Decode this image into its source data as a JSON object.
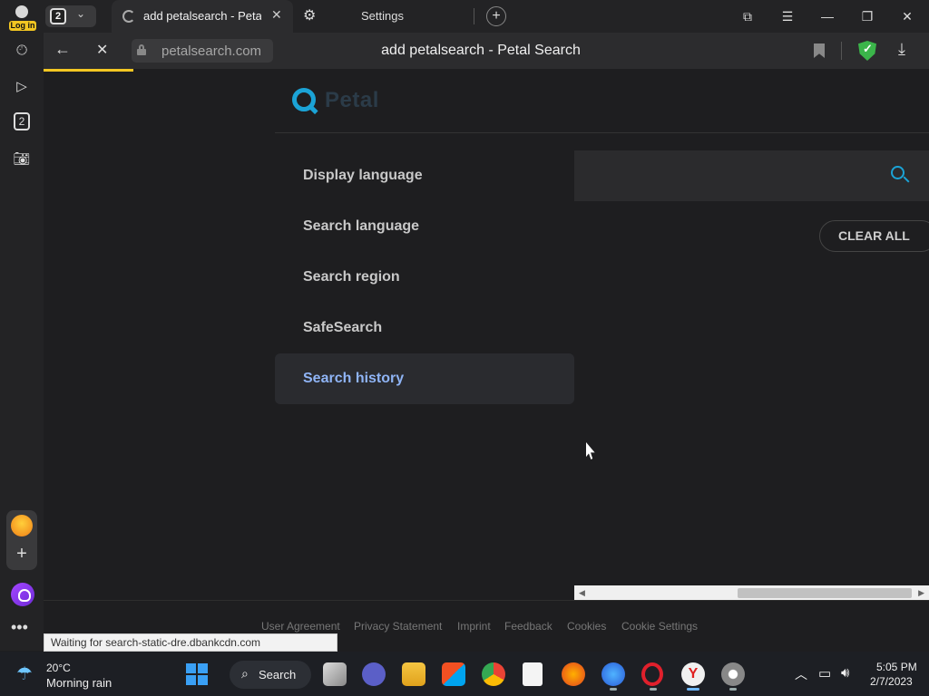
{
  "browser": {
    "login_label": "Log in",
    "tab_count": "2",
    "tabs": [
      {
        "title": "add petalsearch - Petal Search",
        "close": "✕"
      },
      {
        "title": "Settings"
      }
    ],
    "new_tab": "+",
    "window_controls": {
      "minimize": "—",
      "restore": "❐",
      "close": "✕",
      "menu": "☰",
      "collections": "⧉"
    },
    "url": "petalsearch.com",
    "page_title": "add petalsearch - Petal Search",
    "loading_progress": 0.1
  },
  "sidebar": {
    "icons": [
      "history-icon",
      "play-icon",
      "tabs-icon",
      "screenshot-icon",
      "mail-icon",
      "add-icon",
      "alice-icon",
      "more-icon"
    ],
    "tabs_badge": "2"
  },
  "page": {
    "logo_text": "Petal",
    "menu": [
      {
        "label": "Display language"
      },
      {
        "label": "Search language"
      },
      {
        "label": "Search region"
      },
      {
        "label": "SafeSearch"
      },
      {
        "label": "Search history"
      }
    ],
    "active_menu_index": 4,
    "search_placeholder": "",
    "clear_all_label": "CLEAR ALL",
    "footer_links": [
      "User Agreement",
      "Privacy Statement",
      "Imprint",
      "Feedback",
      "Cookies",
      "Cookie Settings"
    ],
    "accent_color": "#1ba3d6"
  },
  "status_bar": {
    "text": "Waiting for search-static-dre.dbankcdn.com"
  },
  "taskbar": {
    "weather_temp": "20°C",
    "weather_desc": "Morning rain",
    "search_label": "Search",
    "time": "5:05 PM",
    "date": "2/7/2023"
  }
}
